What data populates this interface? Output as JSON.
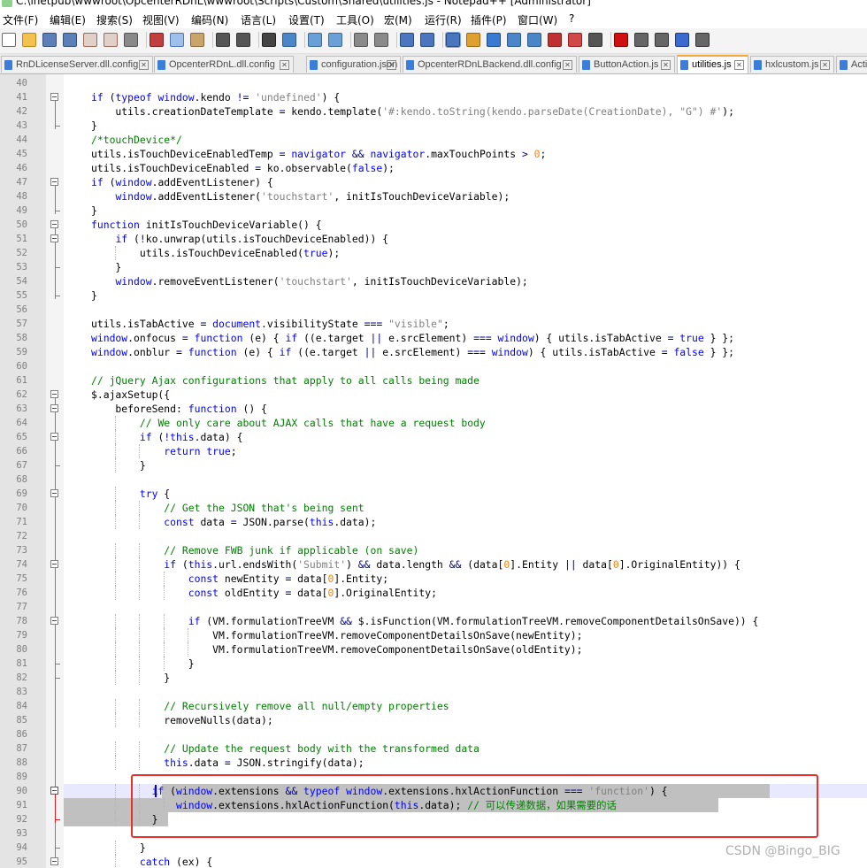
{
  "window": {
    "title": "C:\\inetpub\\wwwroot\\OpcenterRDnL\\wwwroot\\Scripts\\Custom\\Shared\\utilities.js - Notepad++ [Administrator]"
  },
  "menu": [
    "文件(F)",
    "编辑(E)",
    "搜索(S)",
    "视图(V)",
    "编码(N)",
    "语言(L)",
    "设置(T)",
    "工具(O)",
    "宏(M)",
    "运行(R)",
    "插件(P)",
    "窗口(W)",
    "?"
  ],
  "tabs": [
    {
      "label": "RnDLicenseServer.dll.config",
      "active": false
    },
    {
      "label": "OpcenterRDnL.dll.config",
      "active": false
    },
    {
      "label": "configuration.json",
      "active": false
    },
    {
      "label": "OpcenterRDnLBackend.dll.config",
      "active": false
    },
    {
      "label": "ButtonAction.js",
      "active": false
    },
    {
      "label": "utilities.js",
      "active": true
    },
    {
      "label": "hxlcustom.js",
      "active": false
    },
    {
      "label": "Acti",
      "active": false
    }
  ],
  "lines": [
    {
      "n": "40",
      "c": ""
    },
    {
      "n": "41",
      "c": "if (typeof window.kendo != 'undefined') {"
    },
    {
      "n": "42",
      "c": "    utils.creationDateTemplate = kendo.template('#:kendo.toString(kendo.parseDate(CreationDate), \"G\") #');"
    },
    {
      "n": "43",
      "c": "}"
    },
    {
      "n": "44",
      "c": "/*touchDevice*/"
    },
    {
      "n": "45",
      "c": "utils.isTouchDeviceEnabledTemp = navigator && navigator.maxTouchPoints > 0;"
    },
    {
      "n": "46",
      "c": "utils.isTouchDeviceEnabled = ko.observable(false);"
    },
    {
      "n": "47",
      "c": "if (window.addEventListener) {"
    },
    {
      "n": "48",
      "c": "    window.addEventListener('touchstart', initIsTouchDeviceVariable);"
    },
    {
      "n": "49",
      "c": "}"
    },
    {
      "n": "50",
      "c": "function initIsTouchDeviceVariable() {"
    },
    {
      "n": "51",
      "c": "    if (!ko.unwrap(utils.isTouchDeviceEnabled)) {"
    },
    {
      "n": "52",
      "c": "        utils.isTouchDeviceEnabled(true);"
    },
    {
      "n": "53",
      "c": "    }"
    },
    {
      "n": "54",
      "c": "    window.removeEventListener('touchstart', initIsTouchDeviceVariable);"
    },
    {
      "n": "55",
      "c": "}"
    },
    {
      "n": "56",
      "c": ""
    },
    {
      "n": "57",
      "c": "utils.isTabActive = document.visibilityState === \"visible\";"
    },
    {
      "n": "58",
      "c": "window.onfocus = function (e) { if ((e.target || e.srcElement) === window) { utils.isTabActive = true } };"
    },
    {
      "n": "59",
      "c": "window.onblur = function (e) { if ((e.target || e.srcElement) === window) { utils.isTabActive = false } };"
    },
    {
      "n": "60",
      "c": ""
    },
    {
      "n": "61",
      "c": "// jQuery Ajax configurations that apply to all calls being made"
    },
    {
      "n": "62",
      "c": "$.ajaxSetup({"
    },
    {
      "n": "63",
      "c": "    beforeSend: function () {"
    },
    {
      "n": "64",
      "c": "        // We only care about AJAX calls that have a request body"
    },
    {
      "n": "65",
      "c": "        if (!this.data) {"
    },
    {
      "n": "66",
      "c": "            return true;"
    },
    {
      "n": "67",
      "c": "        }"
    },
    {
      "n": "68",
      "c": ""
    },
    {
      "n": "69",
      "c": "        try {"
    },
    {
      "n": "70",
      "c": "            // Get the JSON that's being sent"
    },
    {
      "n": "71",
      "c": "            const data = JSON.parse(this.data);"
    },
    {
      "n": "72",
      "c": ""
    },
    {
      "n": "73",
      "c": "            // Remove FWB junk if applicable (on save)"
    },
    {
      "n": "74",
      "c": "            if (this.url.endsWith('Submit') && data.length && (data[0].Entity || data[0].OriginalEntity)) {"
    },
    {
      "n": "75",
      "c": "                const newEntity = data[0].Entity;"
    },
    {
      "n": "76",
      "c": "                const oldEntity = data[0].OriginalEntity;"
    },
    {
      "n": "77",
      "c": ""
    },
    {
      "n": "78",
      "c": "                if (VM.formulationTreeVM && $.isFunction(VM.formulationTreeVM.removeComponentDetailsOnSave)) {"
    },
    {
      "n": "79",
      "c": "                    VM.formulationTreeVM.removeComponentDetailsOnSave(newEntity);"
    },
    {
      "n": "80",
      "c": "                    VM.formulationTreeVM.removeComponentDetailsOnSave(oldEntity);"
    },
    {
      "n": "81",
      "c": "                }"
    },
    {
      "n": "82",
      "c": "            }"
    },
    {
      "n": "83",
      "c": ""
    },
    {
      "n": "84",
      "c": "            // Recursively remove all null/empty properties"
    },
    {
      "n": "85",
      "c": "            removeNulls(data);"
    },
    {
      "n": "86",
      "c": ""
    },
    {
      "n": "87",
      "c": "            // Update the request body with the transformed data"
    },
    {
      "n": "88",
      "c": "            this.data = JSON.stringify(data);"
    },
    {
      "n": "89",
      "c": ""
    },
    {
      "n": "90",
      "c": "          if (window.extensions && typeof window.extensions.hxlActionFunction === 'function') {"
    },
    {
      "n": "91",
      "c": "              window.extensions.hxlActionFunction(this.data); // 可以传递数据，如果需要的话"
    },
    {
      "n": "92",
      "c": "          }"
    },
    {
      "n": "93",
      "c": ""
    },
    {
      "n": "94",
      "c": "        }"
    },
    {
      "n": "95",
      "c": "        catch (ex) {"
    }
  ],
  "watermark": "CSDN @Bingo_BIG",
  "colors": {
    "keyword": "#0000ff",
    "string": "#808080",
    "comment": "#008000",
    "number": "#ff8000",
    "highlight_box": "#e8322b",
    "active_tab_accent": "#f3a738"
  }
}
